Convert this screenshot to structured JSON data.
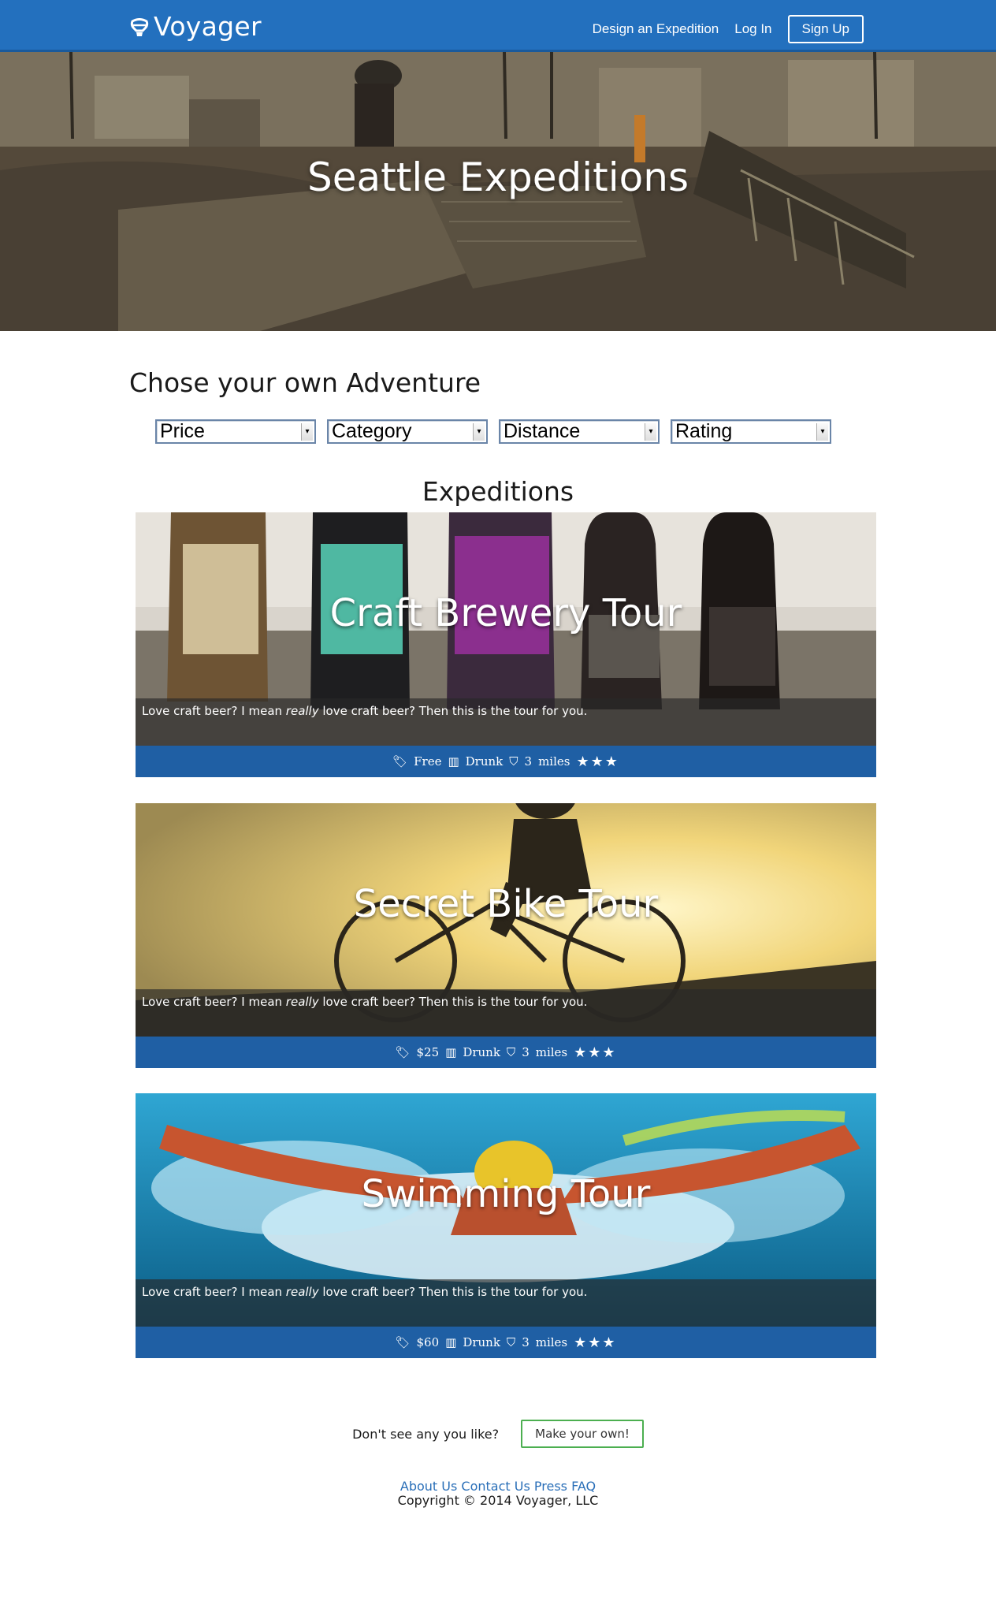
{
  "header": {
    "brand": "Voyager",
    "nav": {
      "design": "Design an Expedition",
      "login": "Log In",
      "signup": "Sign Up"
    }
  },
  "hero": {
    "title": "Seattle Expeditions"
  },
  "filters": {
    "title": "Chose your own Adventure",
    "items": [
      "Price",
      "Category",
      "Distance",
      "Rating"
    ]
  },
  "expeditions": {
    "heading": "Expeditions",
    "cards": [
      {
        "title": "Craft Brewery Tour",
        "desc_pre": "Love craft beer? I mean ",
        "desc_em": "really",
        "desc_post": " love craft beer? Then this is the tour for you.",
        "price": "Free",
        "category": "Drunk",
        "distance": "3",
        "distance_unit": "miles",
        "rating": 3
      },
      {
        "title": "Secret Bike Tour",
        "desc_pre": "Love craft beer? I mean ",
        "desc_em": "really",
        "desc_post": " love craft beer? Then this is the tour for you.",
        "price": "$25",
        "category": "Drunk",
        "distance": "3",
        "distance_unit": "miles",
        "rating": 3
      },
      {
        "title": "Swimming Tour",
        "desc_pre": "Love craft beer? I mean ",
        "desc_em": "really",
        "desc_post": " love craft beer? Then this is the tour for you.",
        "price": "$60",
        "category": "Drunk",
        "distance": "3",
        "distance_unit": "miles",
        "rating": 3
      }
    ]
  },
  "cta": {
    "text": "Don't see any you like?",
    "button": "Make your own!"
  },
  "footer": {
    "links": [
      "About Us",
      "Contact Us",
      "Press",
      "FAQ"
    ],
    "copyright": "Copyright © 2014 Voyager, LLC"
  },
  "icons": {
    "brand": "balloon-icon",
    "price": "tag-icon",
    "category": "beer-icon",
    "distance": "balloon-icon",
    "rating": "star-icon"
  },
  "colors": {
    "nav": "#2370be",
    "meta_bar": "#1f5fa4",
    "link": "#2a6fb8",
    "cta_border": "#4caf50"
  }
}
